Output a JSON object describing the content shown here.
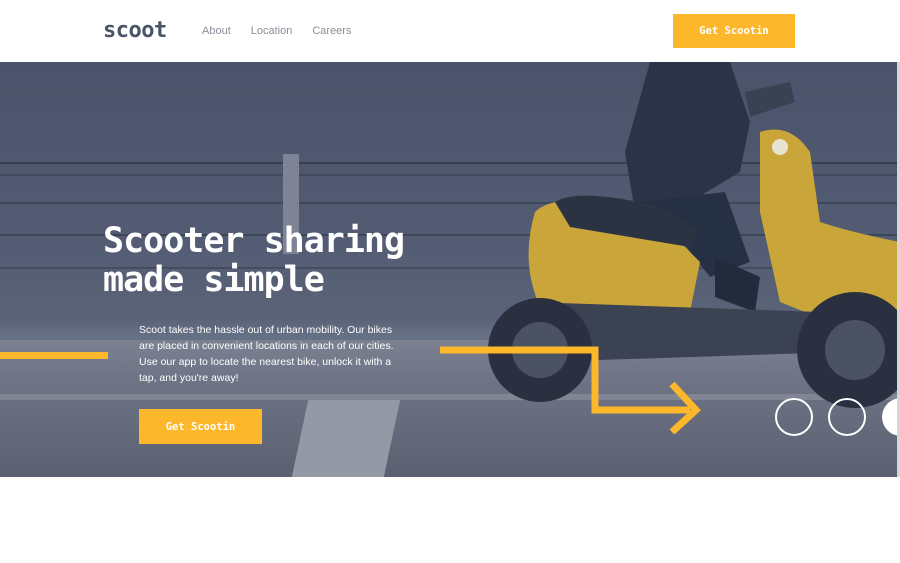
{
  "header": {
    "logo": "scoot",
    "nav": [
      "About",
      "Location",
      "Careers"
    ],
    "cta_label": "Get Scootin"
  },
  "hero": {
    "title_line1": "Scooter sharing",
    "title_line2": "made simple",
    "description": "Scoot takes the hassle out of urban mobility. Our bikes are placed in convenient locations in each of our cities. Use our app to locate the nearest bike, unlock it with a tap, and you're away!",
    "cta_label": "Get Scootin"
  },
  "colors": {
    "accent": "#fcb72b",
    "dark_navy": "#495567",
    "hero_overlay": "#4a5369",
    "nav_text": "#8b8e99"
  },
  "icons": [
    "arrow-right-icon",
    "circle-outline-icon"
  ]
}
